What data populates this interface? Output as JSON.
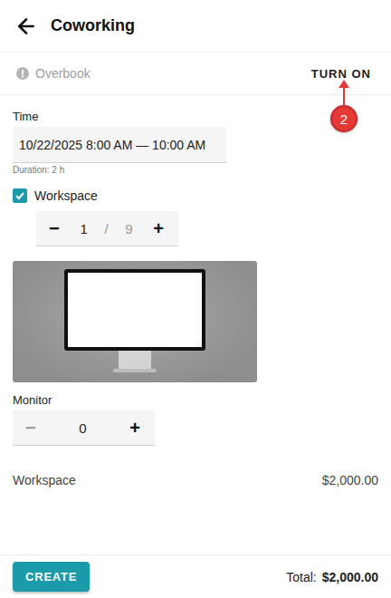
{
  "header": {
    "title": "Coworking"
  },
  "overbook": {
    "label": "Overbook",
    "action": "TURN ON",
    "enabled": false
  },
  "annotation": {
    "number": "2"
  },
  "time": {
    "label": "Time",
    "value": "10/22/2025 8:00 AM — 10:00 AM",
    "duration": "Duration: 2 h"
  },
  "options": [
    {
      "kind": "checkbox",
      "label": "Workspace",
      "checked": true,
      "minus": "−",
      "quantity": "1",
      "separator": "/",
      "max": "9",
      "plus": "+",
      "decrement_disabled": false
    },
    {
      "kind": "stepper",
      "label": "Monitor",
      "minus": "−",
      "quantity": "0",
      "plus": "+",
      "decrement_disabled": true
    }
  ],
  "summary": [
    {
      "label": "Workspace",
      "price": "$2,000.00"
    }
  ],
  "footer": {
    "button": "CREATE",
    "total_label": "Total:",
    "total": "$2,000.00"
  }
}
